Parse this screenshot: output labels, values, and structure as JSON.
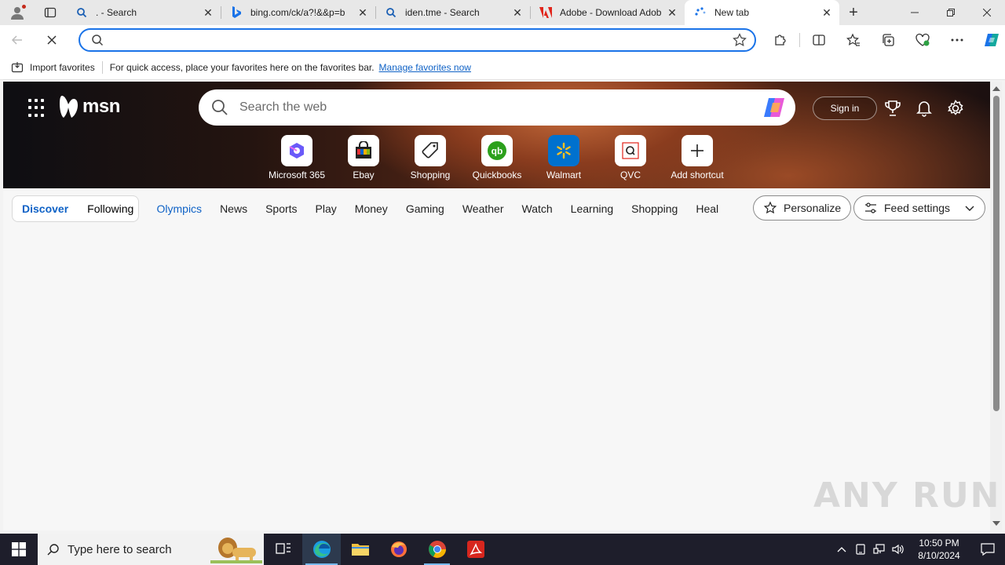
{
  "tabs": [
    {
      "title": ". - Search",
      "icon": "search-icon"
    },
    {
      "title": "bing.com/ck/a?!&&p=b",
      "icon": "bing-icon"
    },
    {
      "title": "iden.tme - Search",
      "icon": "search-icon"
    },
    {
      "title": "Adobe - Download Adob",
      "icon": "adobe-icon"
    },
    {
      "title": "New tab",
      "icon": "loading-icon",
      "active": true
    }
  ],
  "address": {
    "value": "",
    "placeholder": ""
  },
  "favorites_bar": {
    "import_label": "Import favorites",
    "message": "For quick access, place your favorites here on the favorites bar.",
    "manage_link": "Manage favorites now"
  },
  "msn": {
    "logo_text": "msn",
    "search_placeholder": "Search the web",
    "signin_label": "Sign in",
    "shortcuts": [
      {
        "label": "Microsoft 365"
      },
      {
        "label": "Ebay"
      },
      {
        "label": "Shopping"
      },
      {
        "label": "Quickbooks"
      },
      {
        "label": "Walmart"
      },
      {
        "label": "QVC"
      },
      {
        "label": "Add shortcut"
      }
    ],
    "feed_toggle": {
      "discover": "Discover",
      "following": "Following"
    },
    "categories": [
      "Olympics",
      "News",
      "Sports",
      "Play",
      "Money",
      "Gaming",
      "Weather",
      "Watch",
      "Learning",
      "Shopping",
      "Heal"
    ],
    "personalize_label": "Personalize",
    "feed_settings_label": "Feed settings"
  },
  "watermark": "ANY RUN",
  "taskbar": {
    "search_placeholder": "Type here to search",
    "time": "10:50 PM",
    "date": "8/10/2024"
  },
  "colors": {
    "accent": "#0f62c6",
    "address_border": "#1a73e8",
    "taskbar": "#1e1e2b"
  }
}
